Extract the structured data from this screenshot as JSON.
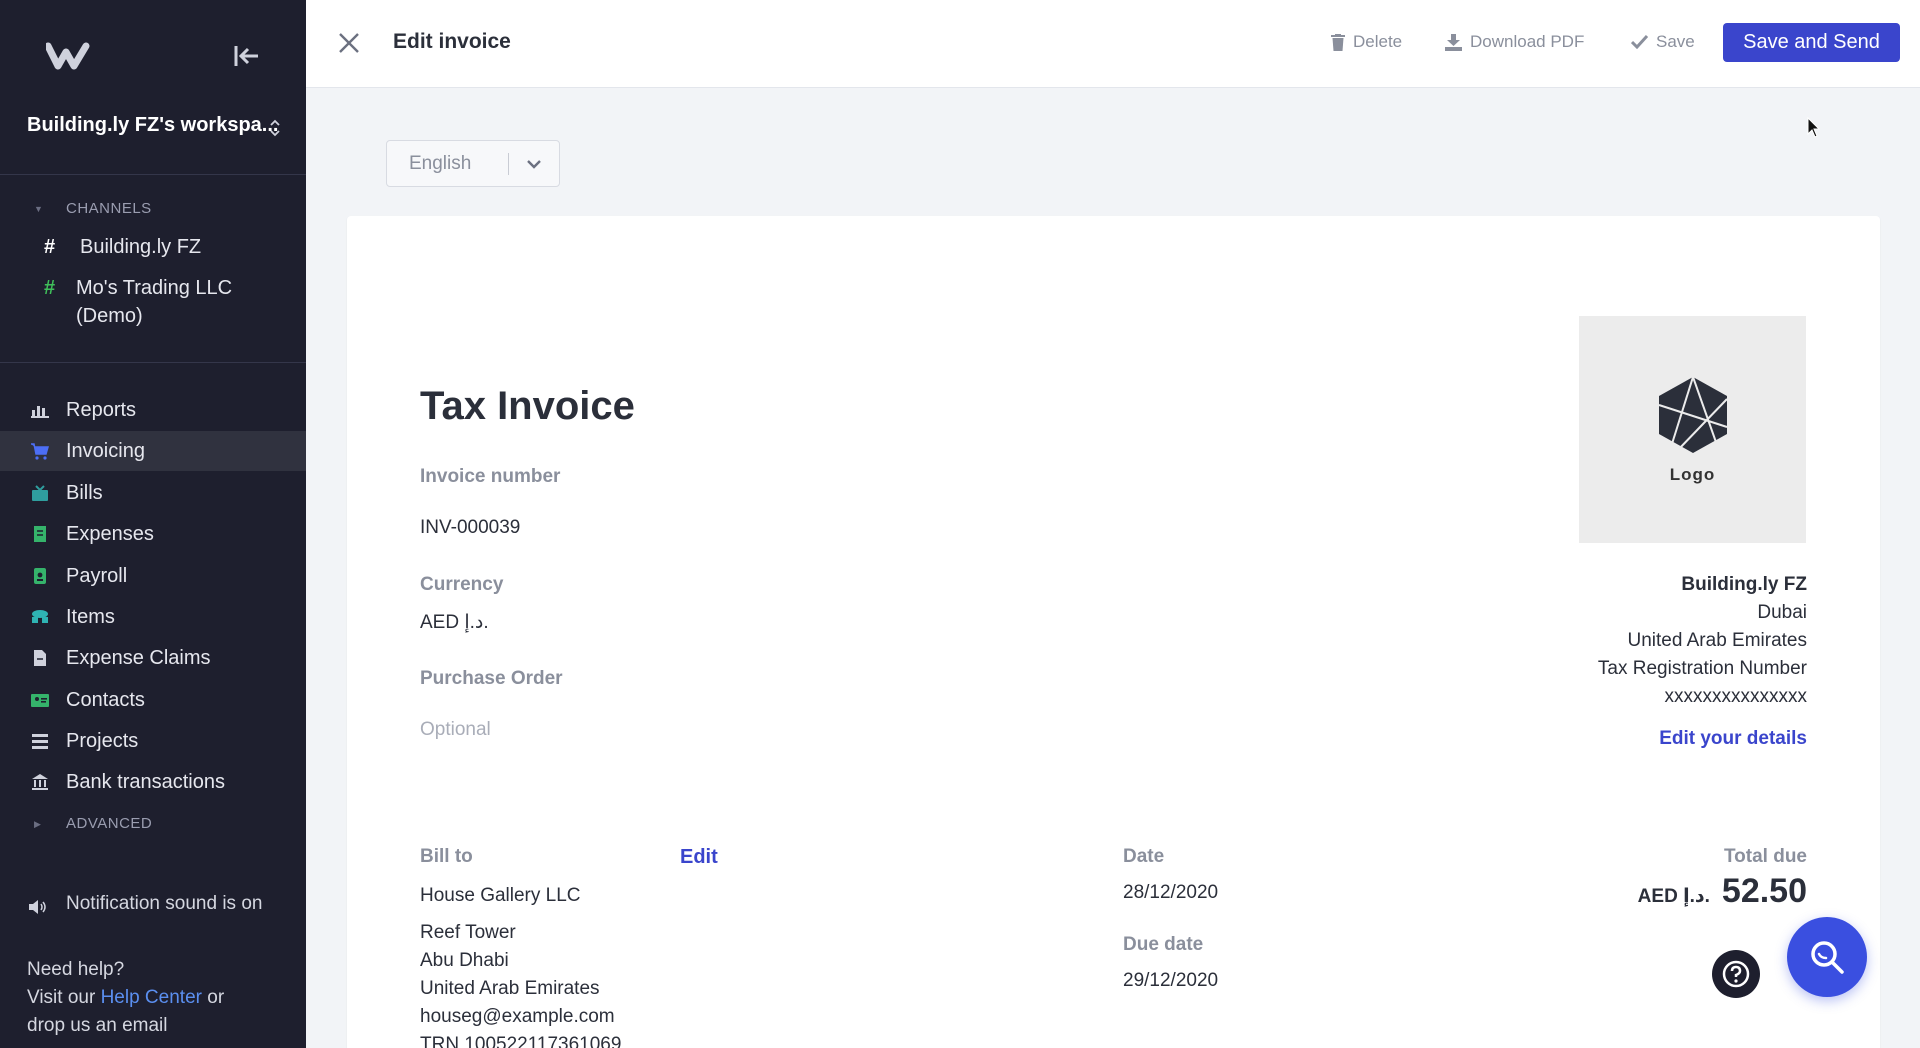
{
  "sidebar": {
    "workspace": "Building.ly FZ's workspa...",
    "channels_heading": "CHANNELS",
    "channels": [
      {
        "label": "Building.ly FZ",
        "color": "#ffffff"
      },
      {
        "label": "Mo's Trading LLC",
        "label2": "(Demo)",
        "color": "#3fbf5a"
      }
    ],
    "nav": [
      {
        "label": "Reports",
        "icon": "bar-chart-icon"
      },
      {
        "label": "Invoicing",
        "icon": "cart-icon",
        "active": true
      },
      {
        "label": "Bills",
        "icon": "inbox-icon"
      },
      {
        "label": "Expenses",
        "icon": "receipt-icon"
      },
      {
        "label": "Payroll",
        "icon": "id-badge-icon"
      },
      {
        "label": "Items",
        "icon": "boxes-icon"
      },
      {
        "label": "Expense Claims",
        "icon": "document-icon"
      },
      {
        "label": "Contacts",
        "icon": "contact-card-icon"
      },
      {
        "label": "Projects",
        "icon": "list-icon"
      },
      {
        "label": "Bank transactions",
        "icon": "bank-icon"
      }
    ],
    "advanced_heading": "ADVANCED",
    "notification": "Notification sound is on",
    "help_line1": "Need help?",
    "help_prefix": "Visit our",
    "help_link": "Help Center",
    "help_suffix": "or",
    "help_line3": "drop us an email"
  },
  "topbar": {
    "title": "Edit invoice",
    "delete": "Delete",
    "download": "Download PDF",
    "save": "Save",
    "save_send": "Save and Send"
  },
  "language": {
    "selected": "English"
  },
  "invoice": {
    "title": "Tax Invoice",
    "number_label": "Invoice number",
    "number": "INV-000039",
    "currency_label": "Currency",
    "currency": "AED د.إ.",
    "po_label": "Purchase Order",
    "po_placeholder": "Optional",
    "logo_text": "Logo",
    "company": {
      "name": "Building.ly FZ",
      "city": "Dubai",
      "country": "United Arab Emirates",
      "trn_label": "Tax Registration Number",
      "trn": "xxxxxxxxxxxxxxx"
    },
    "edit_details": "Edit your details",
    "bill_to_label": "Bill to",
    "bill_to_edit": "Edit",
    "bill_to": {
      "name": "House Gallery LLC",
      "line1": "Reef Tower",
      "line2": "Abu Dhabi",
      "line3": "United Arab Emirates",
      "email": "houseg@example.com",
      "trn": "TRN 100522117361069"
    },
    "date_label": "Date",
    "date": "28/12/2020",
    "due_label": "Due date",
    "due_date": "29/12/2020",
    "total_label": "Total due",
    "total_currency": "AED د.إ.",
    "total_amount": "52.50"
  },
  "colors": {
    "accent": "#3a45cc",
    "sidebar_bg": "#1e1f2e",
    "fab": "#3a4fe0"
  }
}
